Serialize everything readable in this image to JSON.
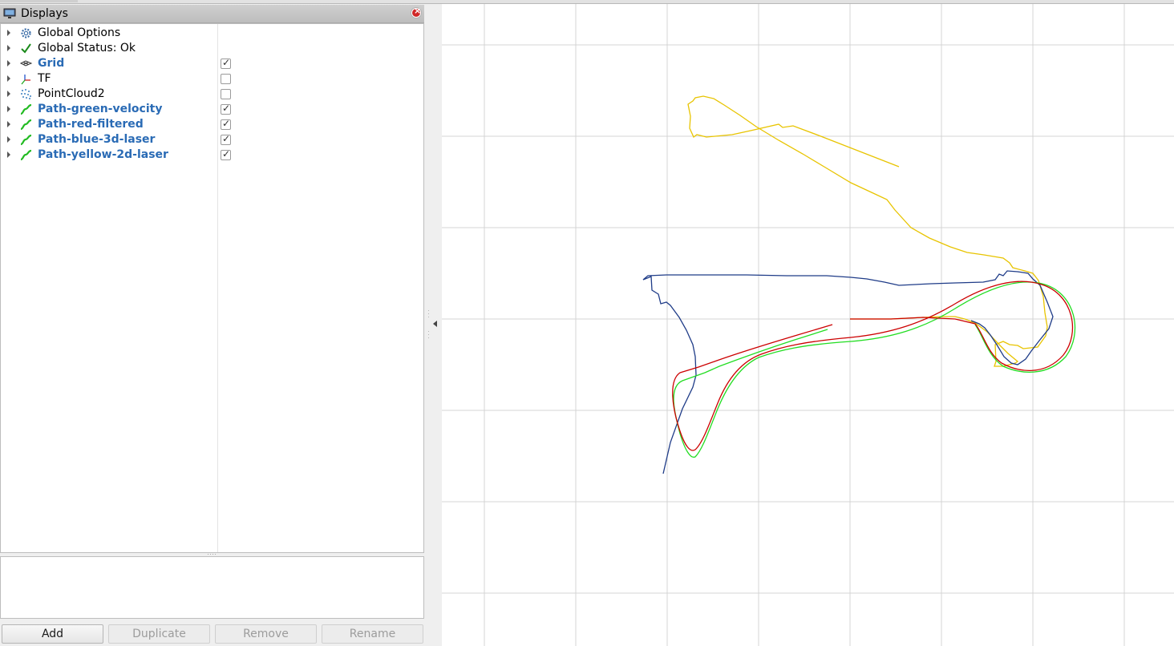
{
  "displays_panel": {
    "title": "Displays",
    "items": [
      {
        "label": "Global Options",
        "icon": "gear-icon",
        "checkbox": null,
        "highlighted": false
      },
      {
        "label": "Global Status: Ok",
        "icon": "checkmark-icon",
        "checkbox": null,
        "highlighted": false
      },
      {
        "label": "Grid",
        "icon": "grid-icon",
        "checkbox": true,
        "highlighted": true
      },
      {
        "label": "TF",
        "icon": "axes-icon",
        "checkbox": false,
        "highlighted": false
      },
      {
        "label": "PointCloud2",
        "icon": "pointcloud-icon",
        "checkbox": false,
        "highlighted": false
      },
      {
        "label": "Path-green-velocity",
        "icon": "path-icon",
        "checkbox": true,
        "highlighted": true
      },
      {
        "label": "Path-red-filtered",
        "icon": "path-icon",
        "checkbox": true,
        "highlighted": true
      },
      {
        "label": "Path-blue-3d-laser",
        "icon": "path-icon",
        "checkbox": true,
        "highlighted": true
      },
      {
        "label": "Path-yellow-2d-laser",
        "icon": "path-icon",
        "checkbox": true,
        "highlighted": true
      }
    ],
    "buttons": {
      "add": "Add",
      "duplicate": "Duplicate",
      "remove": "Remove",
      "rename": "Rename"
    }
  },
  "view": {
    "background_color": "#ffffff",
    "grid_color": "#d4d4d4",
    "paths": [
      {
        "name": "Path-green-velocity",
        "color": "#22dd22"
      },
      {
        "name": "Path-red-filtered",
        "color": "#cc0000"
      },
      {
        "name": "Path-blue-3d-laser",
        "color": "#1f3c88"
      },
      {
        "name": "Path-yellow-2d-laser",
        "color": "#e8c400"
      }
    ]
  }
}
